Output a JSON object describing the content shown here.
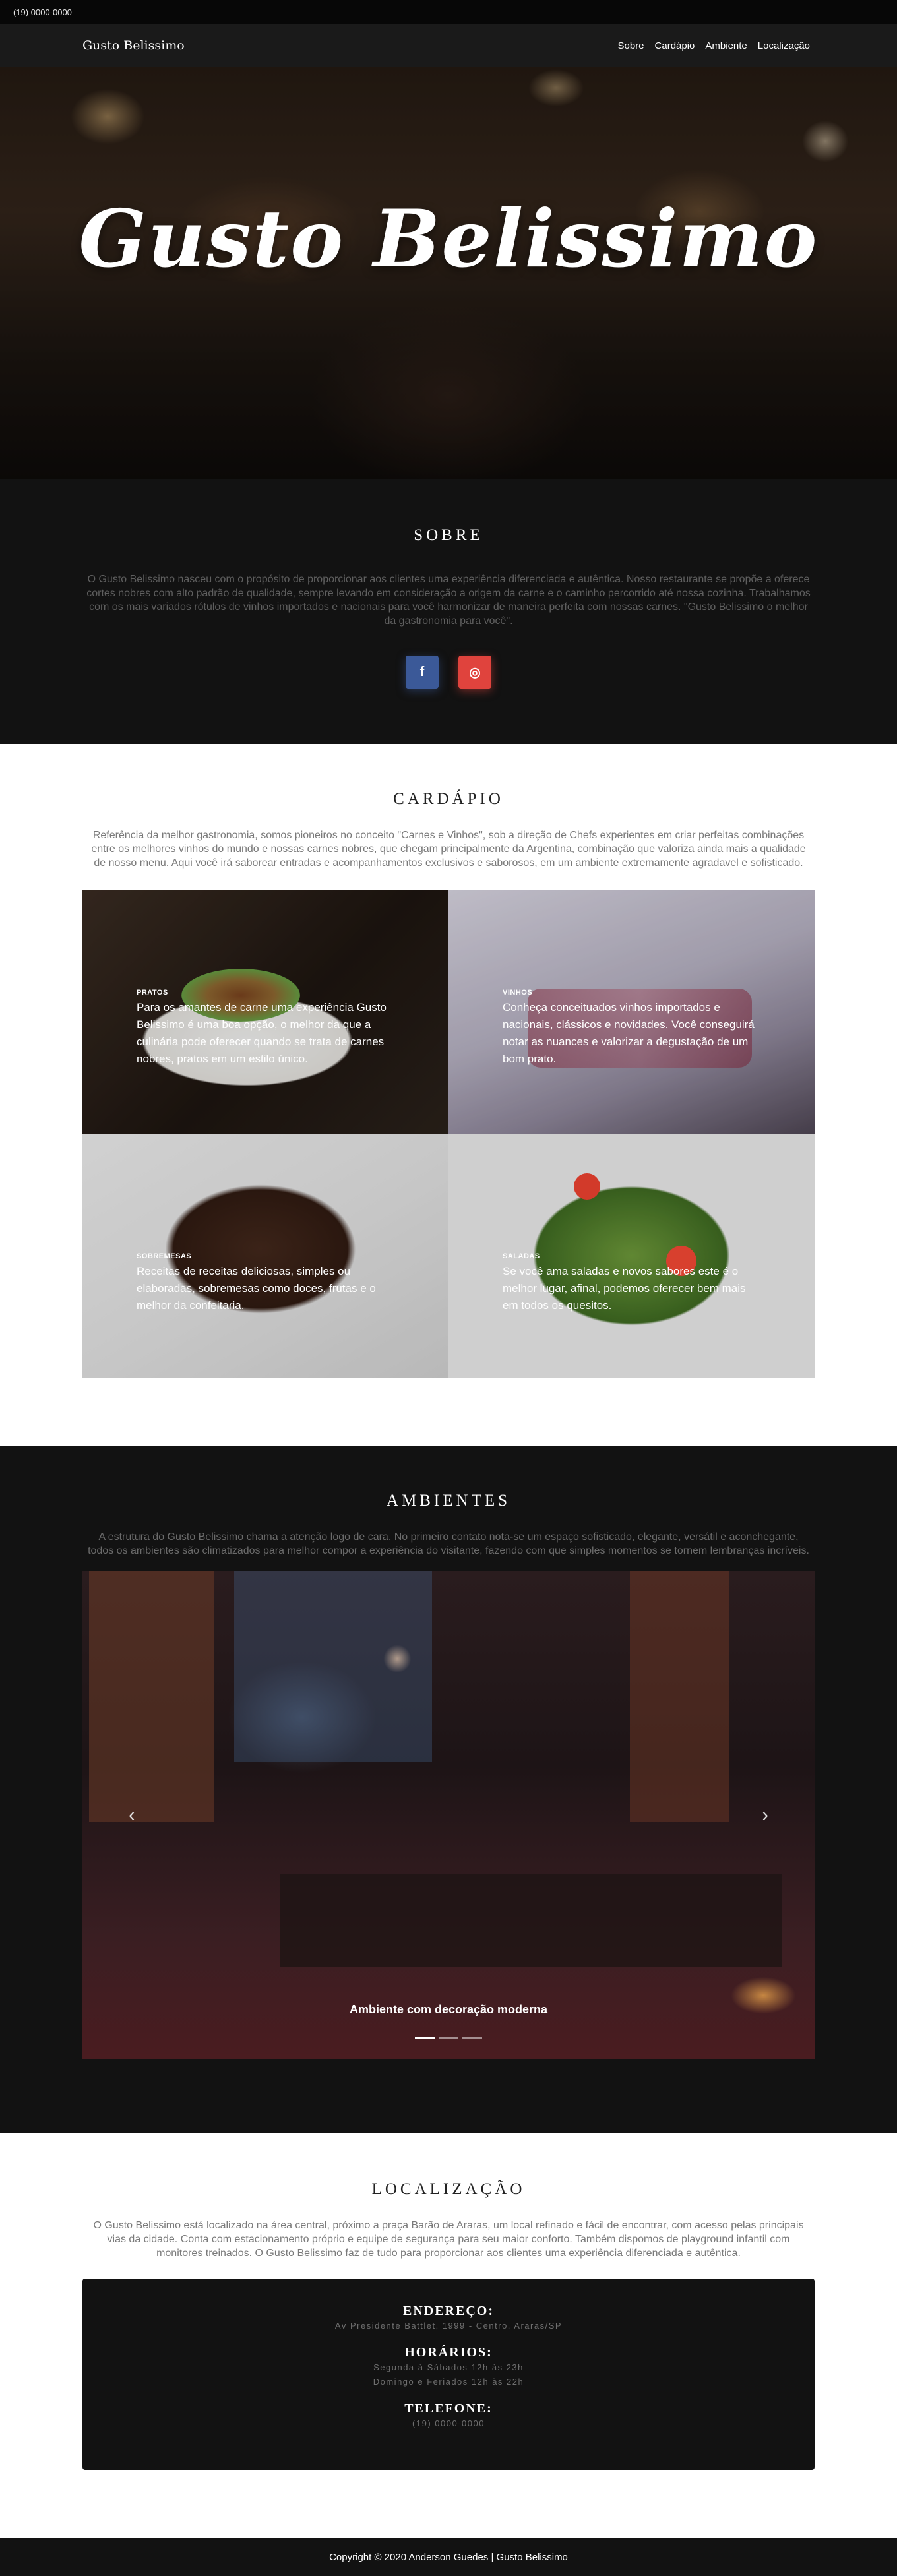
{
  "topbar": {
    "phone": "(19) 0000-0000"
  },
  "navbar": {
    "brand": "Gusto Belissimo",
    "links": [
      "Sobre",
      "Cardápio",
      "Ambiente",
      "Localização"
    ]
  },
  "hero": {
    "title": "Gusto Belissimo"
  },
  "sobre": {
    "title": "SOBRE",
    "text": "O Gusto Belissimo nasceu com o propósito de proporcionar aos clientes uma experiência diferenciada e autêntica. Nosso restaurante se propõe a oferece cortes nobres com alto padrão de qualidade, sempre levando em consideração a origem da carne e o caminho percorrido até nossa cozinha. Trabalhamos com os mais variados rótulos de vinhos importados e nacionais para você harmonizar de maneira perfeita com nossas carnes. \"Gusto Belissimo o melhor da gastronomia para você\".",
    "facebook": "f",
    "instagram": "◎"
  },
  "cardapio": {
    "title": "CARDÁPIO",
    "text": "Referência da melhor gastronomia, somos pioneiros no conceito \"Carnes e Vinhos\", sob a direção de Chefs experientes em criar perfeitas combinações entre os melhores vinhos do mundo e nossas carnes nobres, que chegam principalmente da Argentina, combinação que valoriza ainda mais a qualidade de nosso menu. Aqui você irá saborear entradas e acompanhamentos exclusivos e saborosos, em um ambiente extremamente agradavel e sofisticado.",
    "items": [
      {
        "title": "PRATOS",
        "text": "Para os amantes de carne uma experiência Gusto Belissimo é uma boa opção, o melhor da que a culinária pode oferecer quando se trata de carnes nobres, pratos em um estilo único."
      },
      {
        "title": "VINHOS",
        "text": "Conheça conceituados vinhos importados e nacionais, clássicos e novidades. Você conseguirá notar as nuances e valorizar a degustação de um bom prato."
      },
      {
        "title": "SOBREMESAS",
        "text": "Receitas de receitas deliciosas, simples ou elaboradas, sobremesas como doces, frutas e o melhor da confeitaria."
      },
      {
        "title": "SALADAS",
        "text": "Se você ama saladas e novos sabores este é o melhor lugar, afinal, podemos oferecer bem mais em todos os quesitos."
      }
    ]
  },
  "ambientes": {
    "title": "AMBIENTES",
    "text": "A estrutura do Gusto Belissimo chama a atenção logo de cara. No primeiro contato nota-se um espaço sofisticado, elegante, versátil e aconchegante, todos os ambientes são climatizados para melhor compor a experiência do visitante, fazendo com que simples momentos se tornem lembranças incríveis.",
    "caption": "Ambiente com decoração moderna",
    "prev": "‹",
    "next": "›"
  },
  "localizacao": {
    "title": "LOCALIZAÇÃO",
    "text": "O Gusto Belissimo está localizado na área central, próximo a praça Barão de Araras, um local refinado e fácil de encontrar, com acesso pelas principais vias da cidade. Conta com estacionamento próprio e equipe de segurança para seu maior conforto. Também dispomos de playground infantil com monitores treinados. O Gusto Belissimo faz de tudo para proporcionar aos clientes uma experiência diferenciada e autêntica.",
    "endereco_title": "ENDEREÇO:",
    "endereco": "Av Presidente Battlet, 1999 - Centro, Araras/SP",
    "horarios_title": "HORÁRIOS:",
    "horarios": [
      "Segunda à Sábados 12h às 23h",
      "Domingo e Feriados 12h às 22h"
    ],
    "telefone_title": "TELEFONE:",
    "telefone": "(19) 0000-0000"
  },
  "footer": {
    "copyright": "Copyright © 2020 Anderson Guedes | Gusto Belissimo"
  }
}
